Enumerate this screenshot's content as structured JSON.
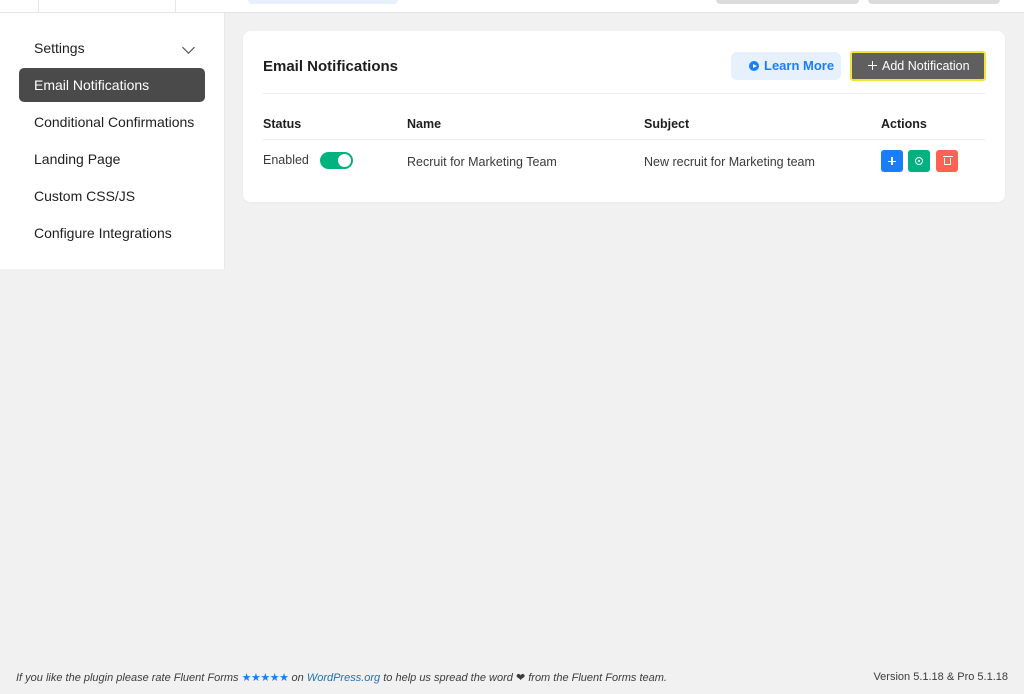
{
  "sidebar": {
    "items": [
      {
        "label": "Settings"
      },
      {
        "label": "Email Notifications"
      },
      {
        "label": "Conditional Confirmations"
      },
      {
        "label": "Landing Page"
      },
      {
        "label": "Custom CSS/JS"
      },
      {
        "label": "Configure Integrations"
      }
    ],
    "active_index": 1
  },
  "card": {
    "title": "Email Notifications",
    "learn_more_label": "Learn More",
    "add_label": "Add Notification",
    "table": {
      "columns": [
        "Status",
        "Name",
        "Subject",
        "Actions"
      ],
      "rows": [
        {
          "status": "Enabled",
          "enabled": true,
          "name": "Recruit for Marketing Team",
          "subject": "New recruit for Marketing team"
        }
      ]
    }
  },
  "footer": {
    "left_prefix": "If you like the plugin please rate Fluent Forms",
    "stars": "★★★★★",
    "on": "on",
    "link": "WordPress.org",
    "left_suffix": "to help us spread the word",
    "heart": "❤",
    "left_end": "from the Fluent Forms team.",
    "version": "Version 5.1.18 & Pro 5.1.18"
  },
  "colors": {
    "primary": "#1a7efb",
    "success": "#00b27f",
    "danger": "#ff6154",
    "active_nav": "#4a4a4a",
    "highlight_border": "#f0e531"
  },
  "icons": [
    "chevron-down-icon",
    "play-circle-icon",
    "plus-icon",
    "gear-icon",
    "trash-icon"
  ]
}
